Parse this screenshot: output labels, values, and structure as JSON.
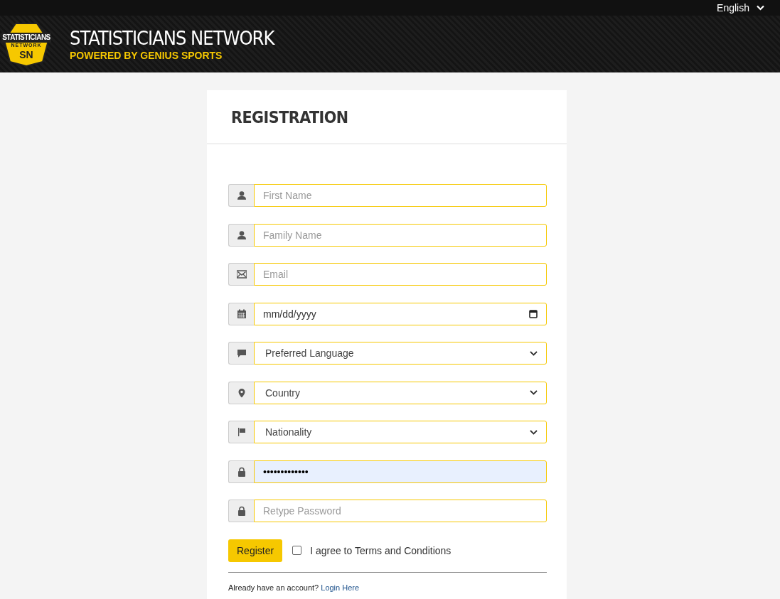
{
  "language_menu": {
    "label": "English"
  },
  "header": {
    "logo": {
      "top": "STATISTICIANS",
      "middle": "NETWORK",
      "bottom": "SN"
    },
    "title": "STATISTICIANS NETWORK",
    "subtitle": "POWERED BY GENIUS SPORTS"
  },
  "form": {
    "title": "REGISTRATION",
    "fields": [
      {
        "kind": "text",
        "placeholder": "First Name"
      },
      {
        "kind": "text",
        "placeholder": "Family Name"
      },
      {
        "kind": "text",
        "placeholder": "Email"
      },
      {
        "kind": "date",
        "placeholder": "mm/dd/yyyy"
      },
      {
        "kind": "select",
        "value": "Preferred Language"
      },
      {
        "kind": "select",
        "value": "Country"
      },
      {
        "kind": "select",
        "value": "Nationality"
      },
      {
        "kind": "password",
        "value": "•••••••••••••",
        "autofilled": true
      },
      {
        "kind": "password",
        "placeholder": "Retype Password"
      }
    ],
    "submit": "Register",
    "terms": {
      "label": "I agree to Terms and Conditions",
      "checked": false
    },
    "footer": {
      "text": "Already have an account?",
      "link": "Login Here"
    }
  }
}
